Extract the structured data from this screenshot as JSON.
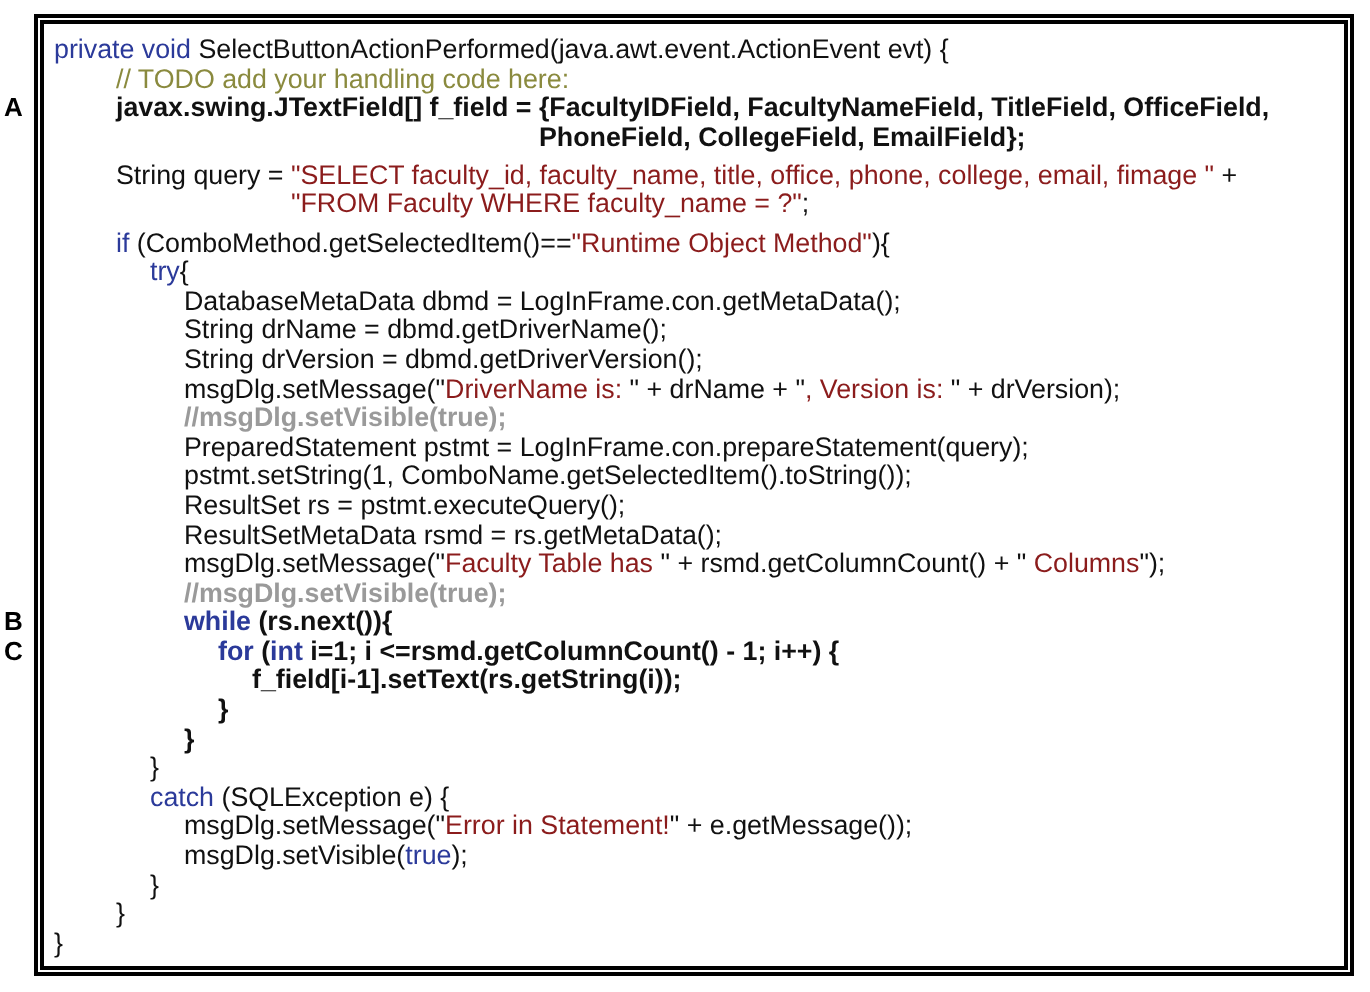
{
  "lines": [
    {
      "segments": [
        {
          "kind": "keyword",
          "text": "private void"
        },
        {
          "kind": "plain",
          "text": " SelectButtonActionPerformed(java.awt.event.ActionEvent evt) {"
        }
      ],
      "closing": "}",
      "children": [
        {
          "segments": [
            {
              "kind": "comment",
              "text": "// TODO add your handling code here:"
            }
          ]
        },
        {
          "marker": "A",
          "bold": true,
          "segments": [
            {
              "kind": "plain",
              "text": "javax.swing.JTextField[] f_field = "
            },
            {
              "kind": "plain",
              "text": "{FacultyIDField, FacultyNameField, TitleField, OfficeField,"
            }
          ],
          "continuation": [
            {
              "kind": "plain",
              "text": "PhoneField, CollegeField, EmailField};"
            }
          ]
        },
        {
          "gap_before": true,
          "segments": [
            {
              "kind": "plain",
              "text": "String query = "
            },
            {
              "kind": "string",
              "text": "\"SELECT faculty_id, faculty_name, title, office, phone, college, email, fimage \""
            },
            {
              "kind": "plain",
              "text": " +"
            }
          ],
          "continuation": [
            {
              "kind": "string",
              "text": "\"FROM Faculty WHERE faculty_name = ?\""
            },
            {
              "kind": "plain",
              "text": ";"
            }
          ]
        },
        {
          "gap_before": true,
          "segments": [
            {
              "kind": "keyword",
              "text": "if"
            },
            {
              "kind": "plain",
              "text": " (ComboMethod.getSelectedItem()=="
            },
            {
              "kind": "string",
              "text": "\"Runtime Object Method\""
            },
            {
              "kind": "plain",
              "text": "){"
            }
          ],
          "closing": "}",
          "children": [
            {
              "segments": [
                {
                  "kind": "keyword",
                  "text": "try"
                },
                {
                  "kind": "plain",
                  "text": "{"
                }
              ],
              "closing": "}",
              "children": [
                {
                  "segments": [
                    {
                      "kind": "plain",
                      "text": "DatabaseMetaData dbmd = LogInFrame.con.getMetaData();"
                    }
                  ]
                },
                {
                  "segments": [
                    {
                      "kind": "plain",
                      "text": "String drName = dbmd.getDriverName();"
                    }
                  ]
                },
                {
                  "segments": [
                    {
                      "kind": "plain",
                      "text": "String drVersion = dbmd.getDriverVersion();"
                    }
                  ]
                },
                {
                  "segments": [
                    {
                      "kind": "plain",
                      "text": "msgDlg.setMessage(\""
                    },
                    {
                      "kind": "string",
                      "text": "DriverName is: "
                    },
                    {
                      "kind": "plain",
                      "text": "\" + drName + \""
                    },
                    {
                      "kind": "string",
                      "text": ", Version is: "
                    },
                    {
                      "kind": "plain",
                      "text": "\" + drVersion);"
                    }
                  ]
                },
                {
                  "segments": [
                    {
                      "kind": "disabled",
                      "text": "//msgDlg.setVisible(true);"
                    }
                  ]
                },
                {
                  "segments": [
                    {
                      "kind": "plain",
                      "text": "PreparedStatement pstmt = LogInFrame.con.prepareStatement(query);"
                    }
                  ]
                },
                {
                  "segments": [
                    {
                      "kind": "plain",
                      "text": "pstmt.setString(1, ComboName.getSelectedItem().toString());"
                    }
                  ]
                },
                {
                  "segments": [
                    {
                      "kind": "plain",
                      "text": "ResultSet rs = pstmt.executeQuery();"
                    }
                  ]
                },
                {
                  "segments": [
                    {
                      "kind": "plain",
                      "text": "ResultSetMetaData rsmd = rs.getMetaData();"
                    }
                  ]
                },
                {
                  "segments": [
                    {
                      "kind": "plain",
                      "text": "msgDlg.setMessage(\""
                    },
                    {
                      "kind": "string",
                      "text": "Faculty Table has "
                    },
                    {
                      "kind": "plain",
                      "text": "\" + rsmd.getColumnCount() + \""
                    },
                    {
                      "kind": "string",
                      "text": " Columns"
                    },
                    {
                      "kind": "plain",
                      "text": "\");"
                    }
                  ]
                },
                {
                  "segments": [
                    {
                      "kind": "disabled",
                      "text": "//msgDlg.setVisible(true);"
                    }
                  ]
                },
                {
                  "marker": "B",
                  "bold": true,
                  "segments": [
                    {
                      "kind": "keyword",
                      "text": "while"
                    },
                    {
                      "kind": "plain",
                      "text": " (rs.next()){"
                    }
                  ],
                  "closing": "}",
                  "children": [
                    {
                      "marker": "C",
                      "bold": true,
                      "segments": [
                        {
                          "kind": "keyword",
                          "text": "for"
                        },
                        {
                          "kind": "plain",
                          "text": " ("
                        },
                        {
                          "kind": "keyword",
                          "text": "int"
                        },
                        {
                          "kind": "plain",
                          "text": " i=1; i <=rsmd.getColumnCount() - 1; i++) {"
                        }
                      ],
                      "closing": "}",
                      "children": [
                        {
                          "bold": true,
                          "segments": [
                            {
                              "kind": "plain",
                              "text": "f_field[i-1].setText(rs.getString(i));"
                            }
                          ]
                        }
                      ]
                    }
                  ]
                }
              ]
            },
            {
              "segments": [
                {
                  "kind": "keyword",
                  "text": "catch"
                },
                {
                  "kind": "plain",
                  "text": " (SQLException e) {"
                }
              ],
              "closing": "}",
              "children": [
                {
                  "segments": [
                    {
                      "kind": "plain",
                      "text": "msgDlg.setMessage(\""
                    },
                    {
                      "kind": "string",
                      "text": "Error in Statement!"
                    },
                    {
                      "kind": "plain",
                      "text": "\" + e.getMessage());"
                    }
                  ]
                },
                {
                  "segments": [
                    {
                      "kind": "plain",
                      "text": "msgDlg.setVisible("
                    },
                    {
                      "kind": "keyword",
                      "text": "true"
                    },
                    {
                      "kind": "plain",
                      "text": ");"
                    }
                  ]
                }
              ]
            }
          ]
        }
      ]
    }
  ]
}
